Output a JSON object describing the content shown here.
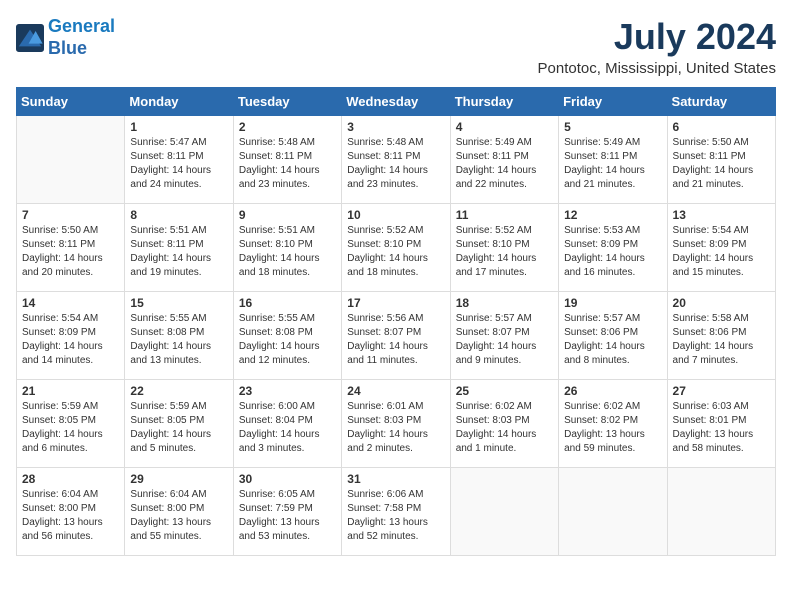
{
  "logo": {
    "line1": "General",
    "line2": "Blue"
  },
  "title": "July 2024",
  "subtitle": "Pontotoc, Mississippi, United States",
  "weekdays": [
    "Sunday",
    "Monday",
    "Tuesday",
    "Wednesday",
    "Thursday",
    "Friday",
    "Saturday"
  ],
  "weeks": [
    [
      {
        "day": "",
        "info": ""
      },
      {
        "day": "1",
        "info": "Sunrise: 5:47 AM\nSunset: 8:11 PM\nDaylight: 14 hours\nand 24 minutes."
      },
      {
        "day": "2",
        "info": "Sunrise: 5:48 AM\nSunset: 8:11 PM\nDaylight: 14 hours\nand 23 minutes."
      },
      {
        "day": "3",
        "info": "Sunrise: 5:48 AM\nSunset: 8:11 PM\nDaylight: 14 hours\nand 23 minutes."
      },
      {
        "day": "4",
        "info": "Sunrise: 5:49 AM\nSunset: 8:11 PM\nDaylight: 14 hours\nand 22 minutes."
      },
      {
        "day": "5",
        "info": "Sunrise: 5:49 AM\nSunset: 8:11 PM\nDaylight: 14 hours\nand 21 minutes."
      },
      {
        "day": "6",
        "info": "Sunrise: 5:50 AM\nSunset: 8:11 PM\nDaylight: 14 hours\nand 21 minutes."
      }
    ],
    [
      {
        "day": "7",
        "info": "Sunrise: 5:50 AM\nSunset: 8:11 PM\nDaylight: 14 hours\nand 20 minutes."
      },
      {
        "day": "8",
        "info": "Sunrise: 5:51 AM\nSunset: 8:11 PM\nDaylight: 14 hours\nand 19 minutes."
      },
      {
        "day": "9",
        "info": "Sunrise: 5:51 AM\nSunset: 8:10 PM\nDaylight: 14 hours\nand 18 minutes."
      },
      {
        "day": "10",
        "info": "Sunrise: 5:52 AM\nSunset: 8:10 PM\nDaylight: 14 hours\nand 18 minutes."
      },
      {
        "day": "11",
        "info": "Sunrise: 5:52 AM\nSunset: 8:10 PM\nDaylight: 14 hours\nand 17 minutes."
      },
      {
        "day": "12",
        "info": "Sunrise: 5:53 AM\nSunset: 8:09 PM\nDaylight: 14 hours\nand 16 minutes."
      },
      {
        "day": "13",
        "info": "Sunrise: 5:54 AM\nSunset: 8:09 PM\nDaylight: 14 hours\nand 15 minutes."
      }
    ],
    [
      {
        "day": "14",
        "info": "Sunrise: 5:54 AM\nSunset: 8:09 PM\nDaylight: 14 hours\nand 14 minutes."
      },
      {
        "day": "15",
        "info": "Sunrise: 5:55 AM\nSunset: 8:08 PM\nDaylight: 14 hours\nand 13 minutes."
      },
      {
        "day": "16",
        "info": "Sunrise: 5:55 AM\nSunset: 8:08 PM\nDaylight: 14 hours\nand 12 minutes."
      },
      {
        "day": "17",
        "info": "Sunrise: 5:56 AM\nSunset: 8:07 PM\nDaylight: 14 hours\nand 11 minutes."
      },
      {
        "day": "18",
        "info": "Sunrise: 5:57 AM\nSunset: 8:07 PM\nDaylight: 14 hours\nand 9 minutes."
      },
      {
        "day": "19",
        "info": "Sunrise: 5:57 AM\nSunset: 8:06 PM\nDaylight: 14 hours\nand 8 minutes."
      },
      {
        "day": "20",
        "info": "Sunrise: 5:58 AM\nSunset: 8:06 PM\nDaylight: 14 hours\nand 7 minutes."
      }
    ],
    [
      {
        "day": "21",
        "info": "Sunrise: 5:59 AM\nSunset: 8:05 PM\nDaylight: 14 hours\nand 6 minutes."
      },
      {
        "day": "22",
        "info": "Sunrise: 5:59 AM\nSunset: 8:05 PM\nDaylight: 14 hours\nand 5 minutes."
      },
      {
        "day": "23",
        "info": "Sunrise: 6:00 AM\nSunset: 8:04 PM\nDaylight: 14 hours\nand 3 minutes."
      },
      {
        "day": "24",
        "info": "Sunrise: 6:01 AM\nSunset: 8:03 PM\nDaylight: 14 hours\nand 2 minutes."
      },
      {
        "day": "25",
        "info": "Sunrise: 6:02 AM\nSunset: 8:03 PM\nDaylight: 14 hours\nand 1 minute."
      },
      {
        "day": "26",
        "info": "Sunrise: 6:02 AM\nSunset: 8:02 PM\nDaylight: 13 hours\nand 59 minutes."
      },
      {
        "day": "27",
        "info": "Sunrise: 6:03 AM\nSunset: 8:01 PM\nDaylight: 13 hours\nand 58 minutes."
      }
    ],
    [
      {
        "day": "28",
        "info": "Sunrise: 6:04 AM\nSunset: 8:00 PM\nDaylight: 13 hours\nand 56 minutes."
      },
      {
        "day": "29",
        "info": "Sunrise: 6:04 AM\nSunset: 8:00 PM\nDaylight: 13 hours\nand 55 minutes."
      },
      {
        "day": "30",
        "info": "Sunrise: 6:05 AM\nSunset: 7:59 PM\nDaylight: 13 hours\nand 53 minutes."
      },
      {
        "day": "31",
        "info": "Sunrise: 6:06 AM\nSunset: 7:58 PM\nDaylight: 13 hours\nand 52 minutes."
      },
      {
        "day": "",
        "info": ""
      },
      {
        "day": "",
        "info": ""
      },
      {
        "day": "",
        "info": ""
      }
    ]
  ]
}
